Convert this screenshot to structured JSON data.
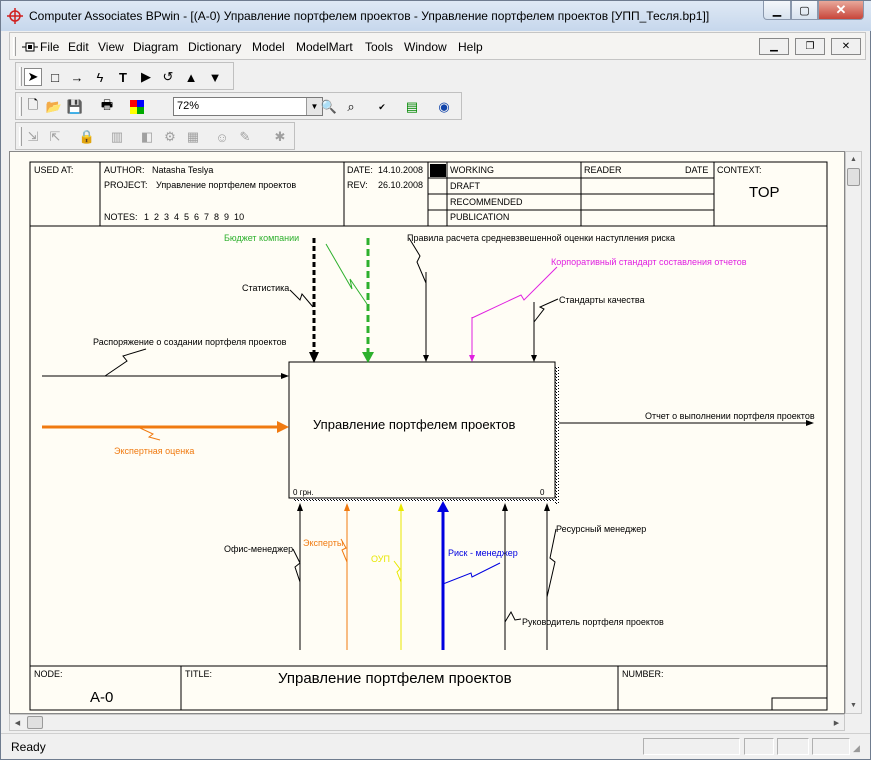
{
  "window": {
    "title": "Computer Associates BPwin  - [(A-0) Управление портфелем проектов  - Управление портфелем проектов  [УПП_Тесля.bp1]]"
  },
  "menu": [
    "File",
    "Edit",
    "View",
    "Diagram",
    "Dictionary",
    "Model",
    "ModelMart",
    "Tools",
    "Window",
    "Help"
  ],
  "toolbar": {
    "zoom": "72%"
  },
  "header": {
    "used_at": "USED AT:",
    "author_label": "AUTHOR:",
    "author": "Natasha Teslya",
    "project_label": "PROJECT:",
    "project": "Управление портфелем проектов",
    "notes_label": "NOTES:",
    "notes": "1  2  3  4  5  6  7  8  9  10",
    "date_label": "DATE:",
    "date": "14.10.2008",
    "rev_label": "REV:",
    "rev": "26.10.2008",
    "status": [
      "WORKING",
      "DRAFT",
      "RECOMMENDED",
      "PUBLICATION"
    ],
    "reader": "READER",
    "reader_date": "DATE",
    "context": "CONTEXT:",
    "context_value": "TOP"
  },
  "diagram": {
    "activity": "Управление портфелем проектов",
    "cost": "0 грн.",
    "number": "0",
    "controls": [
      {
        "label": "Бюджет компании",
        "color": "#2db02d"
      },
      {
        "label": "Статистика",
        "color": "#000000"
      },
      {
        "label": "Правила расчета средневзвешенной оценки наступления риска",
        "color": "#000000"
      },
      {
        "label": "Корпоративный стандарт составления отчетов",
        "color": "#e020e0"
      },
      {
        "label": "Стандарты качества",
        "color": "#000000"
      }
    ],
    "inputs": [
      {
        "label": "Распоряжение о создании портфеля проектов",
        "color": "#000000"
      },
      {
        "label": "Экспертная оценка",
        "color": "#f07a10"
      }
    ],
    "outputs": [
      {
        "label": "Отчет о выполнении портфеля проектов",
        "color": "#000000"
      }
    ],
    "mechanisms": [
      {
        "label": "Офис-менеджер",
        "color": "#000000"
      },
      {
        "label": "Эксперты",
        "color": "#f07a10"
      },
      {
        "label": "ОУП",
        "color": "#e8e800"
      },
      {
        "label": "Риск - менеджер",
        "color": "#0000e0"
      },
      {
        "label": "Руководитель портфеля проектов",
        "color": "#000000"
      },
      {
        "label": "Ресурсный менеджер",
        "color": "#000000"
      }
    ]
  },
  "footer": {
    "node_label": "NODE:",
    "node": "A-0",
    "title_label": "TITLE:",
    "title": "Управление портфелем проектов",
    "number_label": "NUMBER:"
  },
  "status": {
    "text": "Ready"
  }
}
